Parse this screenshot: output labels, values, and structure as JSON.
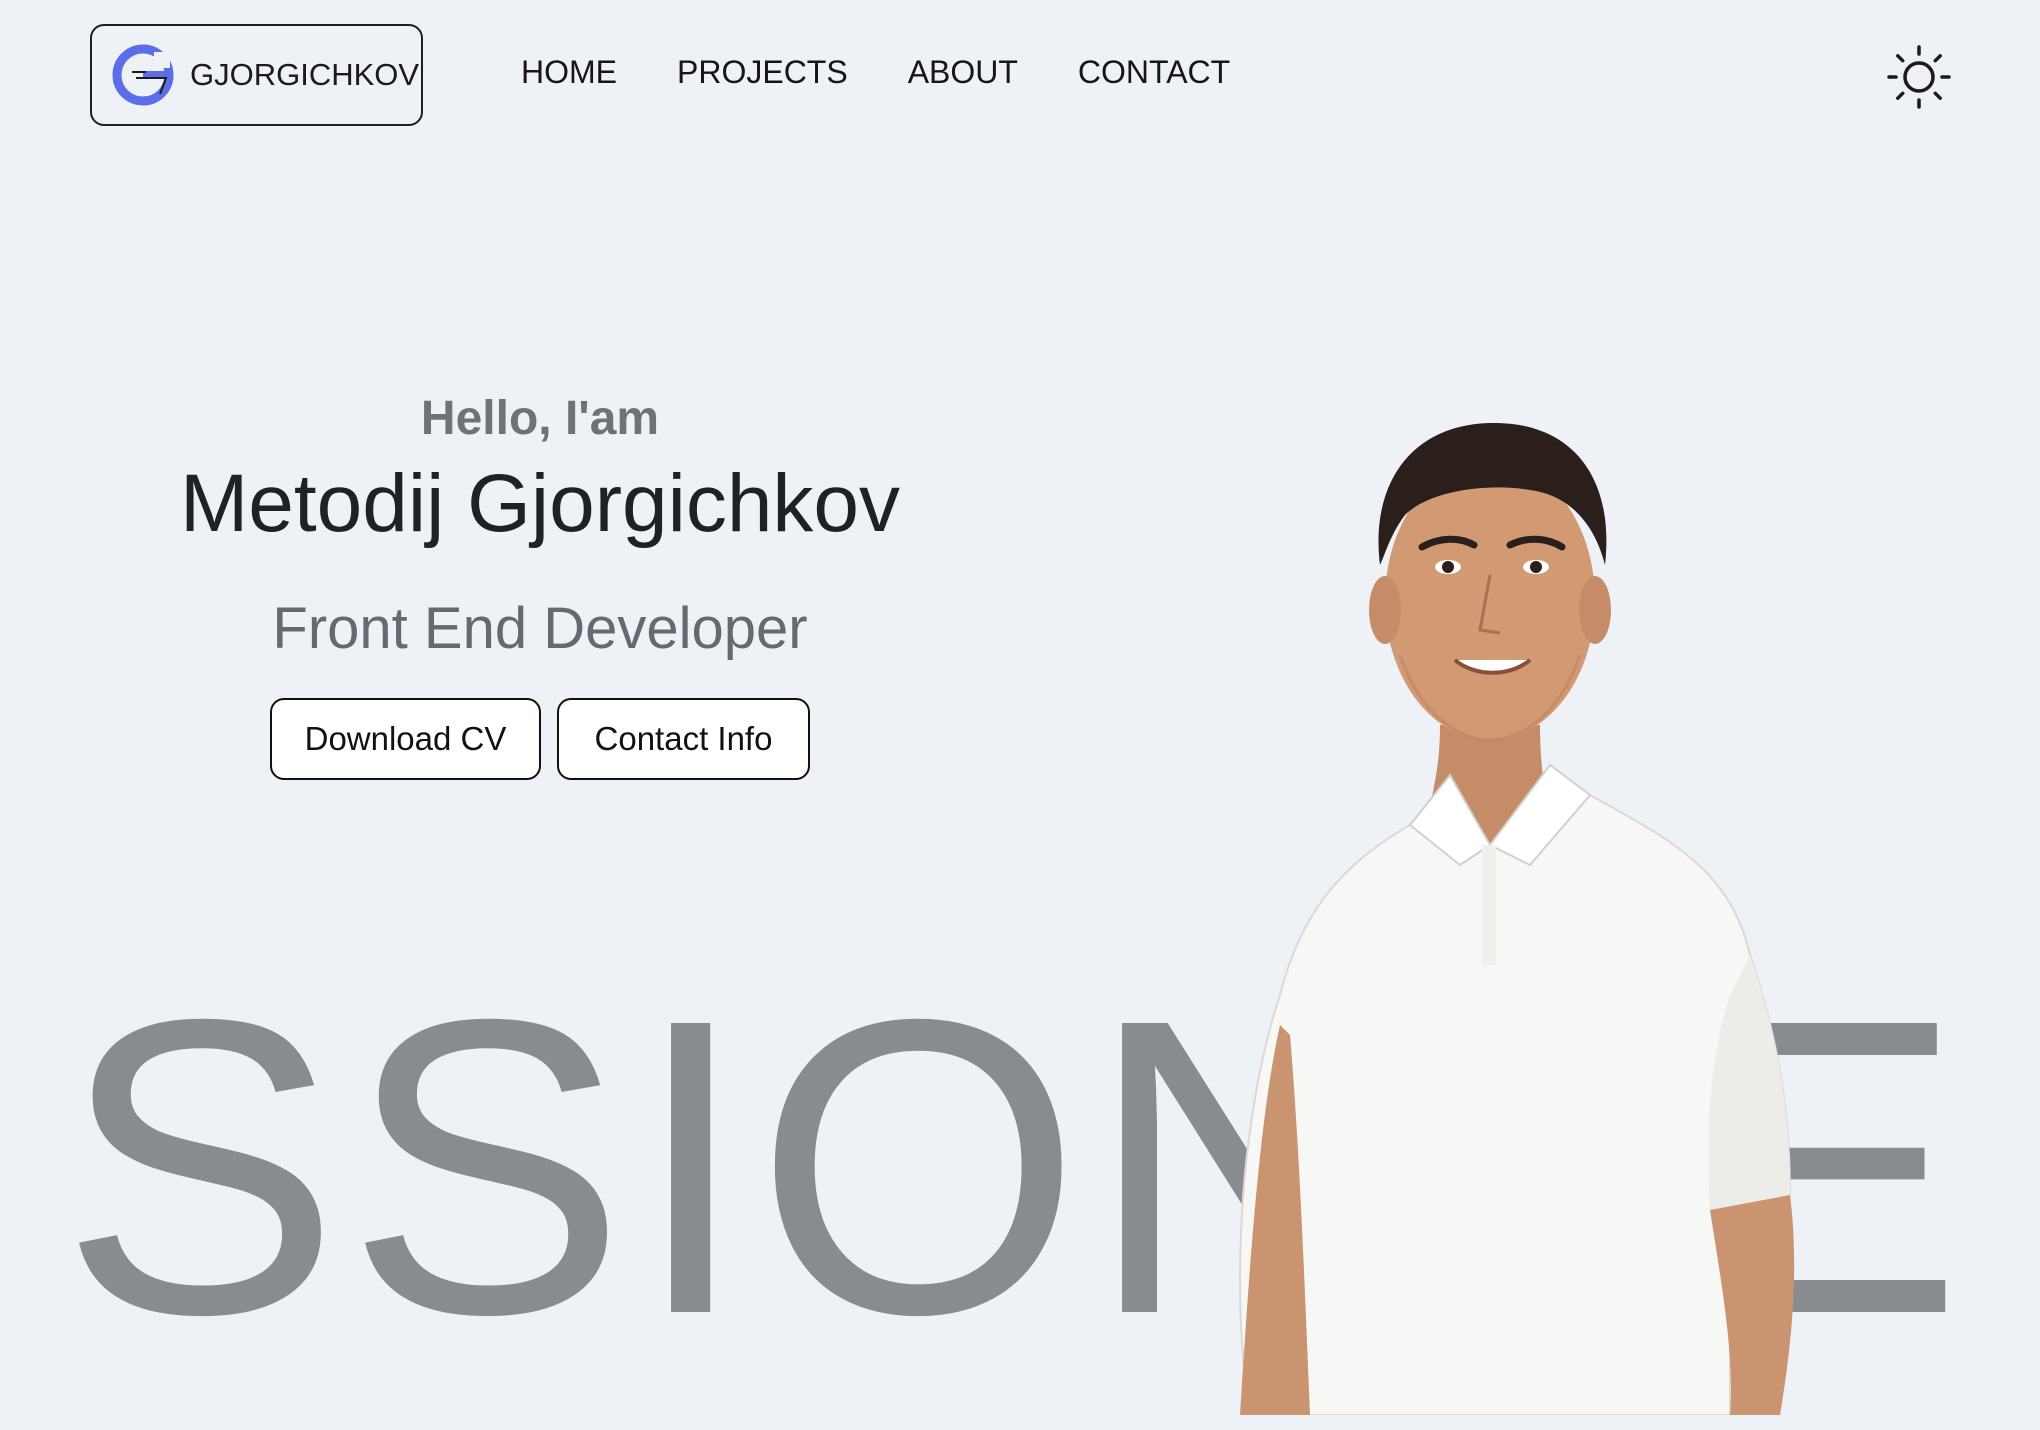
{
  "header": {
    "logo_text": "GJORGICHKOV",
    "nav": [
      "HOME",
      "PROJECTS",
      "ABOUT",
      "CONTACT"
    ],
    "theme_icon": "sun-icon"
  },
  "hero": {
    "greeting": "Hello, I'am",
    "name": "Metodij Gjorgichkov",
    "role": "Front End Developer",
    "buttons": {
      "download_cv": "Download CV",
      "contact_info": "Contact Info"
    }
  },
  "background_word": "SSIONAE",
  "colors": {
    "background": "#eef1f6",
    "text_dark": "#1e2126",
    "text_muted": "#666a70",
    "accent_logo": "#5b6ee8",
    "bg_word": "#888b8f"
  }
}
